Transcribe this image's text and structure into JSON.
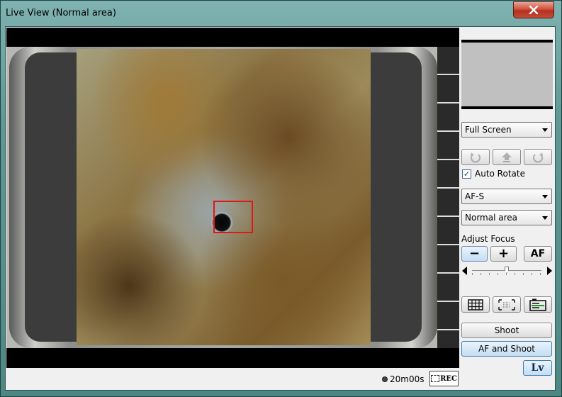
{
  "window": {
    "title": "Live View (Normal area)"
  },
  "status": {
    "timer": "20m00s",
    "rec_label": "REC"
  },
  "panel": {
    "display_mode": "Full Screen",
    "auto_rotate_label": "Auto Rotate",
    "auto_rotate_checked": true,
    "focus_mode": "AF-S",
    "af_area": "Normal area",
    "adjust_focus_label": "Adjust Focus",
    "focus_minus": "−",
    "focus_plus": "+",
    "af_label": "AF",
    "shoot_label": "Shoot",
    "af_shoot_label": "AF and Shoot",
    "lv_label": "Lv"
  },
  "icons": [
    "close-icon",
    "rotate-left-icon",
    "upload-icon",
    "rotate-right-icon",
    "grid-icon",
    "frame-icon",
    "histogram-icon",
    "film-icon"
  ],
  "colors": {
    "focus_box": "#e01818",
    "accent_blue": "#c4ddf3"
  }
}
